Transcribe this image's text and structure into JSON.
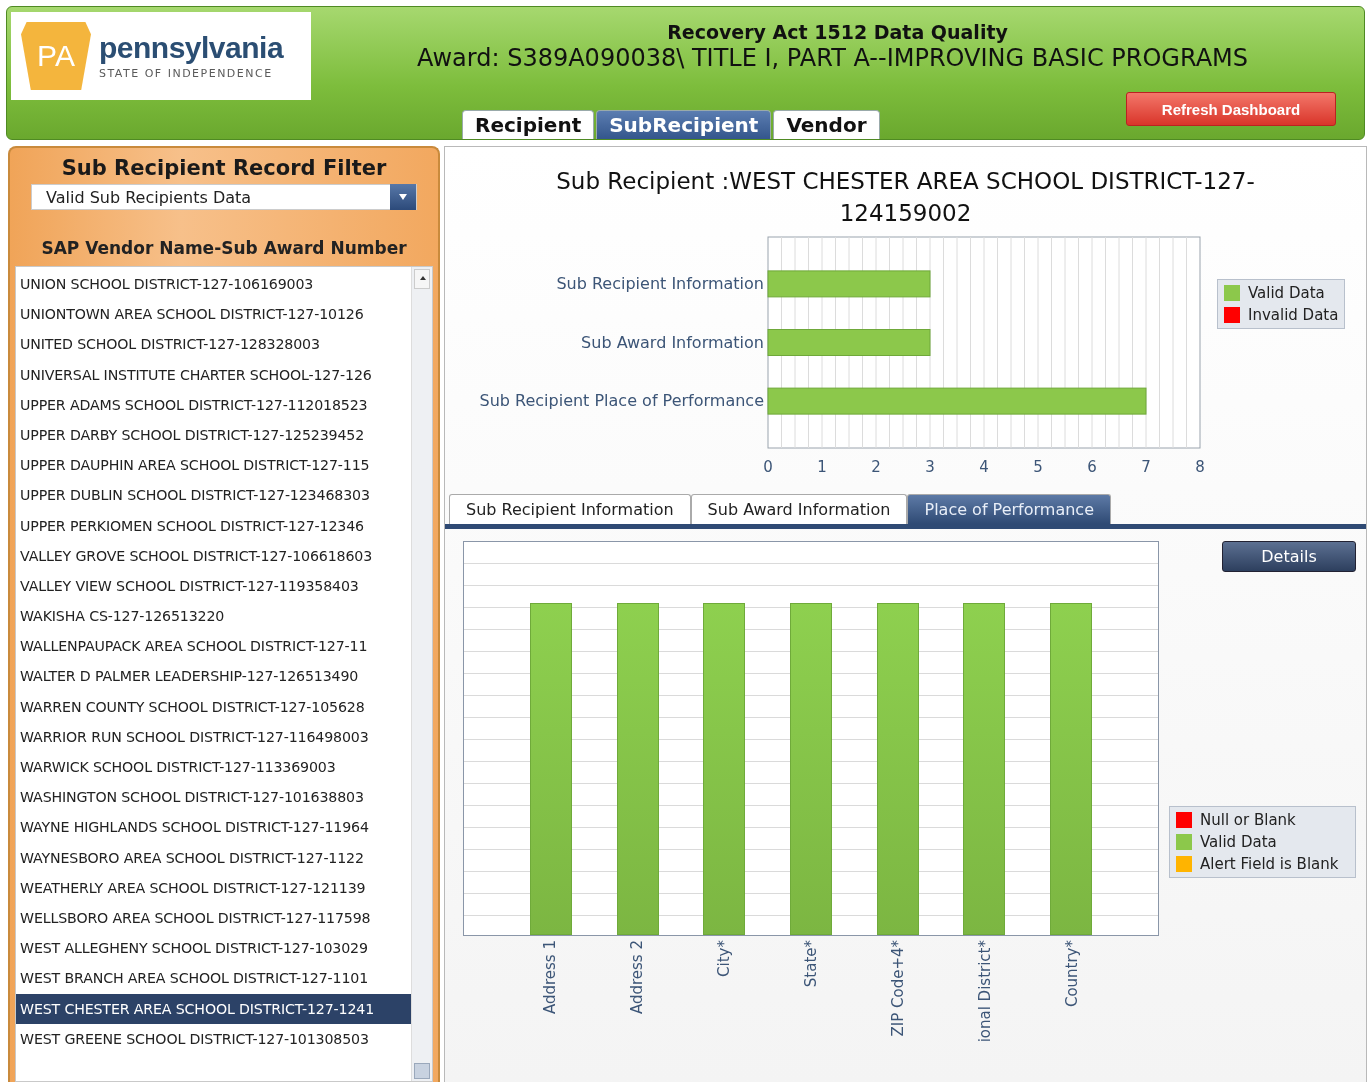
{
  "header": {
    "logo_mark": "PA",
    "logo_name": "pennsylvania",
    "logo_tagline": "STATE OF INDEPENDENCE",
    "title": "Recovery Act 1512 Data Quality",
    "award": "Award: S389A090038\\ TITLE I, PART A--IMPROVING BASIC PROGRAMS",
    "refresh_button": "Refresh Dashboard"
  },
  "tabs": [
    {
      "label": "Recipient",
      "selected": false
    },
    {
      "label": "SubRecipient",
      "selected": true
    },
    {
      "label": "Vendor",
      "selected": false
    }
  ],
  "filter_panel": {
    "title": "Sub Recipient Record Filter",
    "filter_dropdown": {
      "value": "Valid Sub Recipients Data"
    },
    "list_heading": "SAP Vendor Name-Sub Award Number",
    "items": [
      {
        "label": "UNION SCHOOL DISTRICT-127-106169003",
        "selected": false
      },
      {
        "label": "UNIONTOWN AREA SCHOOL DISTRICT-127-10126",
        "selected": false
      },
      {
        "label": "UNITED SCHOOL DISTRICT-127-128328003",
        "selected": false
      },
      {
        "label": "UNIVERSAL INSTITUTE CHARTER SCHOOL-127-126",
        "selected": false
      },
      {
        "label": "UPPER ADAMS SCHOOL DISTRICT-127-112018523",
        "selected": false
      },
      {
        "label": "UPPER DARBY SCHOOL DISTRICT-127-125239452",
        "selected": false
      },
      {
        "label": "UPPER DAUPHIN AREA SCHOOL DISTRICT-127-115",
        "selected": false
      },
      {
        "label": "UPPER DUBLIN SCHOOL DISTRICT-127-123468303",
        "selected": false
      },
      {
        "label": "UPPER PERKIOMEN SCHOOL DISTRICT-127-12346",
        "selected": false
      },
      {
        "label": "VALLEY GROVE SCHOOL DISTRICT-127-106618603",
        "selected": false
      },
      {
        "label": "VALLEY VIEW SCHOOL DISTRICT-127-119358403",
        "selected": false
      },
      {
        "label": "WAKISHA CS-127-126513220",
        "selected": false
      },
      {
        "label": "WALLENPAUPACK AREA SCHOOL DISTRICT-127-11",
        "selected": false
      },
      {
        "label": "WALTER D PALMER LEADERSHIP-127-126513490",
        "selected": false
      },
      {
        "label": "WARREN COUNTY SCHOOL DISTRICT-127-105628",
        "selected": false
      },
      {
        "label": "WARRIOR RUN SCHOOL DISTRICT-127-116498003",
        "selected": false
      },
      {
        "label": "WARWICK SCHOOL DISTRICT-127-113369003",
        "selected": false
      },
      {
        "label": "WASHINGTON SCHOOL DISTRICT-127-101638803",
        "selected": false
      },
      {
        "label": "WAYNE HIGHLANDS SCHOOL DISTRICT-127-11964",
        "selected": false
      },
      {
        "label": "WAYNESBORO AREA SCHOOL DISTRICT-127-1122",
        "selected": false
      },
      {
        "label": "WEATHERLY AREA SCHOOL DISTRICT-127-121139",
        "selected": false
      },
      {
        "label": "WELLSBORO AREA SCHOOL DISTRICT-127-117598",
        "selected": false
      },
      {
        "label": "WEST ALLEGHENY SCHOOL DISTRICT-127-103029",
        "selected": false
      },
      {
        "label": "WEST BRANCH AREA SCHOOL DISTRICT-127-1101",
        "selected": false
      },
      {
        "label": "WEST CHESTER AREA SCHOOL DISTRICT-127-1241",
        "selected": true
      },
      {
        "label": "WEST GREENE SCHOOL DISTRICT-127-101308503",
        "selected": false
      }
    ]
  },
  "detail_panel": {
    "title": "Sub Recipient :WEST CHESTER AREA SCHOOL DISTRICT-127-124159002",
    "summary_chart": {
      "chart_data": {
        "type": "bar",
        "orientation": "horizontal",
        "categories": [
          "Sub Recipient Information",
          "Sub Award Information",
          "Sub Recipient Place of Performance"
        ],
        "series": [
          {
            "name": "Valid Data",
            "color": "#8cc84b",
            "values": [
              3,
              3,
              7
            ]
          },
          {
            "name": "Invalid Data",
            "color": "#ff0000",
            "values": [
              0,
              0,
              0
            ]
          }
        ],
        "xlim": [
          0,
          8
        ],
        "xticks": [
          0,
          1,
          2,
          3,
          4,
          5,
          6,
          7,
          8
        ],
        "grid": true
      }
    },
    "section_tabs": [
      {
        "label": "Sub Recipient Information",
        "selected": false
      },
      {
        "label": "Sub Award Information",
        "selected": false
      },
      {
        "label": "Place of Performance",
        "selected": true
      }
    ],
    "details_button": "Details",
    "field_chart": {
      "x_labels": [
        "Address 1",
        "Address 2",
        "City*",
        "State*",
        "ZIP Code+4*",
        "ional District*",
        "Country*"
      ],
      "legend": [
        {
          "label": "Null or Blank",
          "color": "#ff0000"
        },
        {
          "label": "Valid Data",
          "color": "#8cc84b"
        },
        {
          "label": "Alert Field is Blank",
          "color": "#ffb400"
        }
      ]
    }
  }
}
